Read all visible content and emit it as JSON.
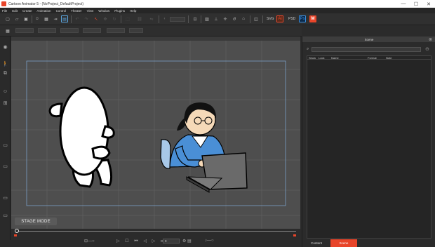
{
  "window": {
    "title": "Cartoon Animator 5 - (NoProject_DefaultProject)",
    "minimize": "—",
    "maximize": "☐",
    "close": "✕"
  },
  "menu": [
    "File",
    "Edit",
    "Create",
    "Animation",
    "Control",
    "Theater",
    "View",
    "Window",
    "Plugins",
    "Help"
  ],
  "toolbar": {
    "svg_label": "SVG",
    "psd_label": "PSD"
  },
  "stage": {
    "mode_button": "STAGE MODE"
  },
  "timeline": {
    "frame": "0"
  },
  "panel": {
    "title": "Scene",
    "columns": [
      "Show",
      "Lock",
      "Name",
      "Format",
      "Note"
    ],
    "tabs": [
      {
        "label": "Content"
      },
      {
        "label": "Scene"
      }
    ]
  },
  "colors": {
    "accent": "#e8452a",
    "stage": "#4e4e4e",
    "shirt": "#4a8fd6",
    "selection": "#7aa0c8"
  }
}
